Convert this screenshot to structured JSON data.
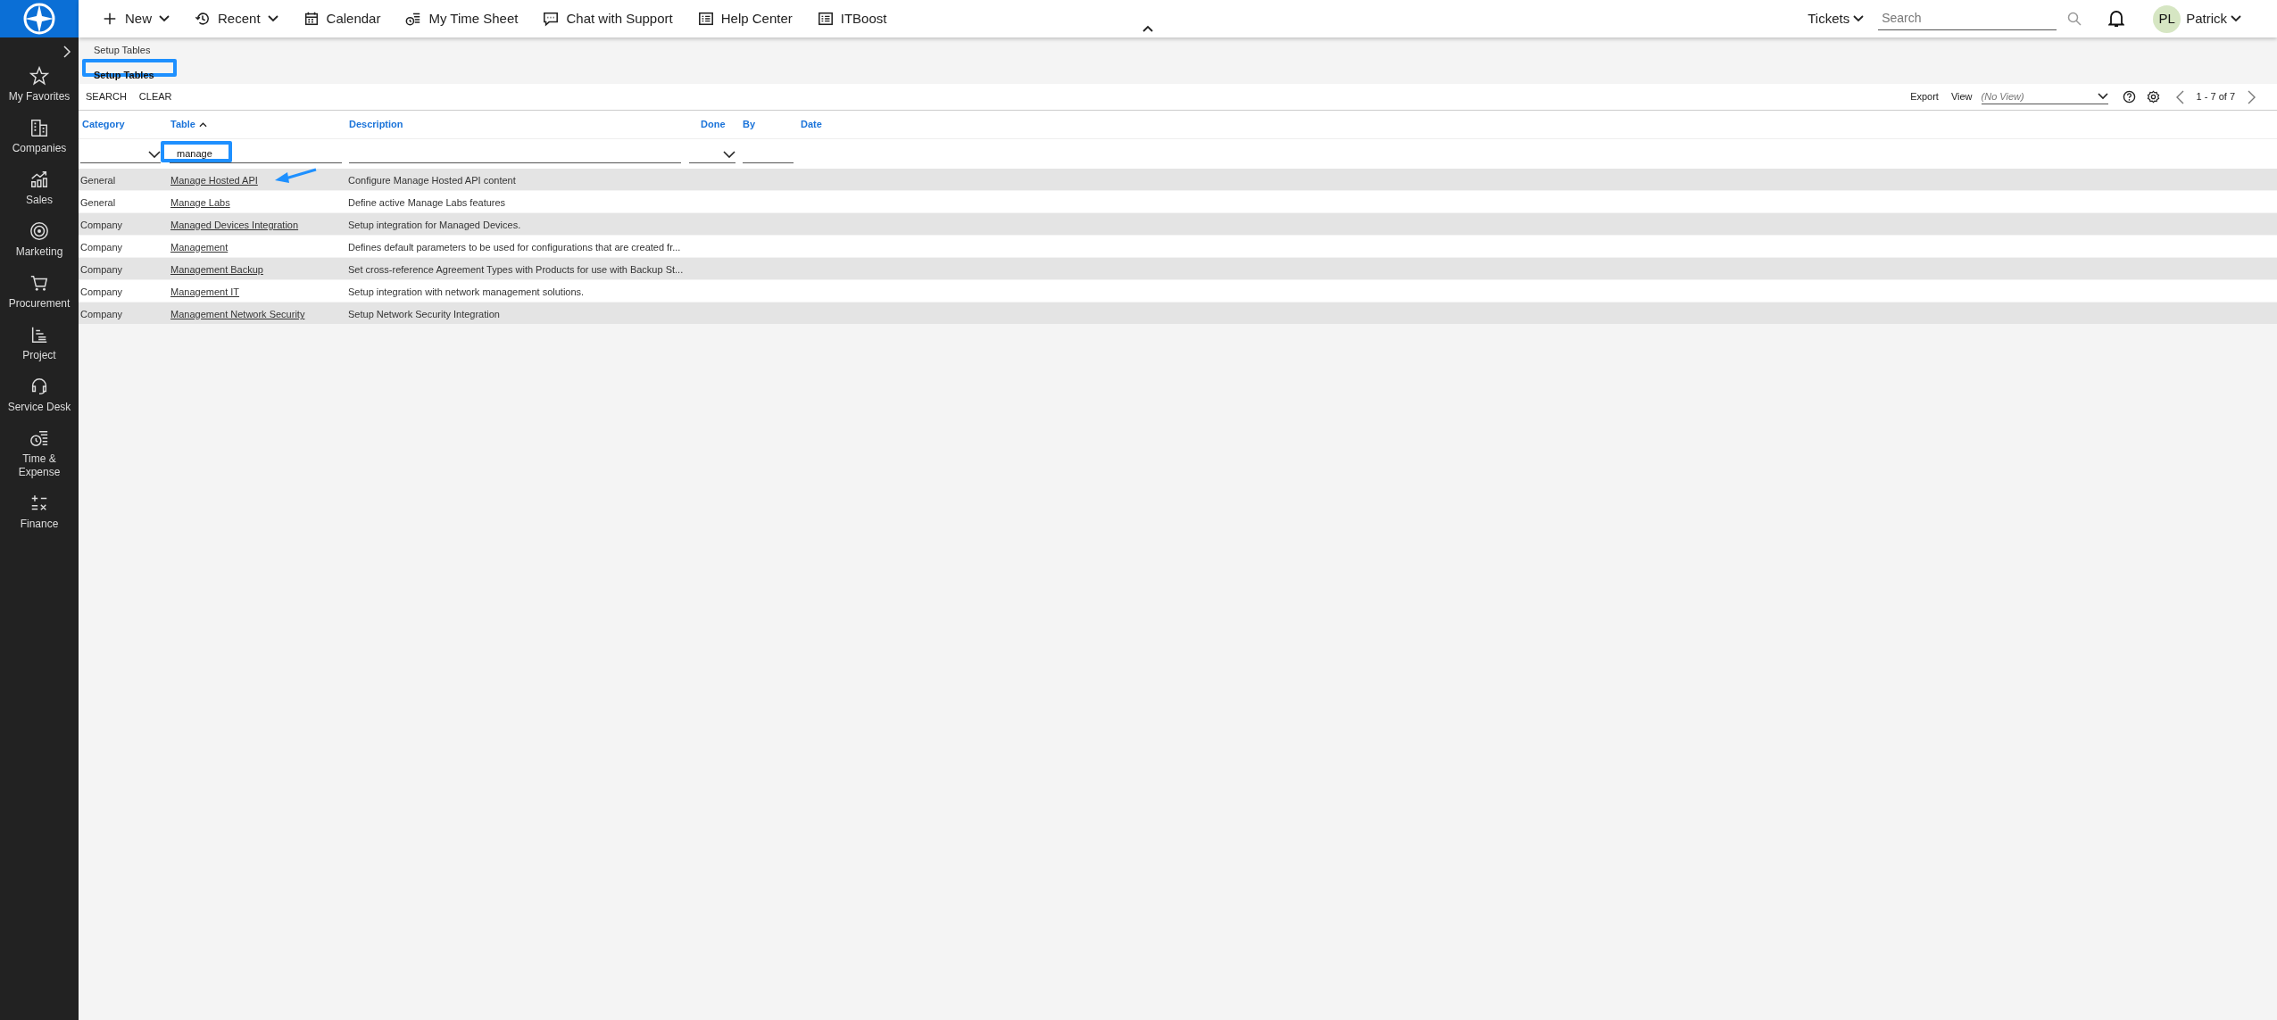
{
  "topbar": {
    "menus": [
      {
        "label": "New",
        "has_menu": true
      },
      {
        "label": "Recent",
        "has_menu": true
      },
      {
        "label": "Calendar",
        "has_menu": false
      },
      {
        "label": "My Time Sheet",
        "has_menu": false
      },
      {
        "label": "Chat with Support",
        "has_menu": false
      },
      {
        "label": "Help Center",
        "has_menu": false
      },
      {
        "label": "ITBoost",
        "has_menu": false
      }
    ],
    "tickets_menu": "Tickets",
    "search": {
      "placeholder": "Search"
    },
    "user": {
      "initials": "PL",
      "name": "Patrick"
    }
  },
  "sidebar": {
    "items": [
      {
        "label": "My Favorites"
      },
      {
        "label": "Companies"
      },
      {
        "label": "Sales"
      },
      {
        "label": "Marketing"
      },
      {
        "label": "Procurement"
      },
      {
        "label": "Project"
      },
      {
        "label": "Service Desk"
      },
      {
        "label": "Time & Expense"
      },
      {
        "label": "Finance"
      }
    ]
  },
  "breadcrumb": "Setup Tables",
  "page_title": "Setup Tables",
  "toolbar": {
    "actions": [
      "SEARCH",
      "CLEAR"
    ],
    "export": "Export",
    "view_label": "View",
    "view": {
      "placeholder": "(No View)"
    },
    "pagination": "1 - 7 of 7"
  },
  "table": {
    "columns": [
      {
        "label": "Category",
        "sorted": false
      },
      {
        "label": "Table",
        "sorted": true
      },
      {
        "label": "Description",
        "sorted": false
      },
      {
        "label": "Done",
        "sorted": false
      },
      {
        "label": "By",
        "sorted": false
      },
      {
        "label": "Date",
        "sorted": false
      }
    ],
    "filters": [
      {
        "kind": "select"
      },
      {
        "kind": "text",
        "value": "manage"
      },
      {
        "kind": "text"
      },
      {
        "kind": "select"
      },
      {
        "kind": "text"
      }
    ],
    "rows": [
      {
        "category": "General",
        "table": "Manage Hosted API",
        "description": "Configure Manage Hosted API content"
      },
      {
        "category": "General",
        "table": "Manage Labs",
        "description": "Define active Manage Labs features"
      },
      {
        "category": "Company",
        "table": "Managed Devices Integration",
        "description": "Setup integration for Managed Devices."
      },
      {
        "category": "Company",
        "table": "Management",
        "description": "Defines default parameters to be used for configurations that are created fr..."
      },
      {
        "category": "Company",
        "table": "Management Backup",
        "description": "Set cross-reference Agreement Types with Products for use with Backup St..."
      },
      {
        "category": "Company",
        "table": "Management IT",
        "description": "Setup integration with network management solutions."
      },
      {
        "category": "Company",
        "table": "Management Network Security",
        "description": "Setup Network Security Integration"
      }
    ]
  }
}
